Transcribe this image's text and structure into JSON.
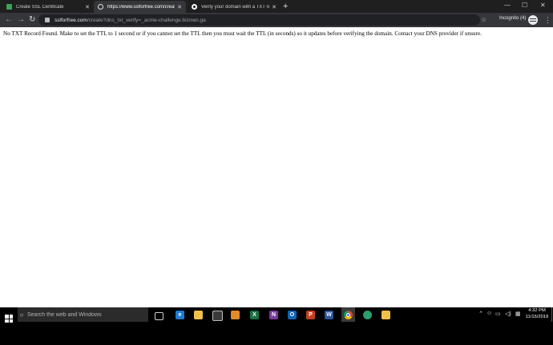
{
  "browser": {
    "tabs": [
      {
        "title": "Create SSL Certificate",
        "favicon": "lock-icon"
      },
      {
        "title": "https://www.sslforfree.com/create",
        "favicon": "globe-icon",
        "active": true
      },
      {
        "title": "Verify your domain with a TXT re",
        "favicon": "google-icon"
      }
    ],
    "toolbar": {
      "url_host": "sslforfree.com",
      "url_path": "/create?dns_txt_verify=_acme-challenge.bizown.ga",
      "profile_label": "Incognito (4)"
    }
  },
  "page": {
    "message": "No TXT Record Found. Make to set the TTL to 1 second or if you cannot set the TTL then you must wait the TTL (in seconds) so it updates before verifying the domain. Contact your DNS provider if unsure."
  },
  "taskbar": {
    "search_placeholder": "Search the web and Windows",
    "apps": [
      {
        "name": "task-view",
        "letter": "",
        "color": "#000000"
      },
      {
        "name": "edge",
        "letter": "e",
        "color": "#1e7ad1"
      },
      {
        "name": "file-explorer",
        "letter": "",
        "color": "#f0c04a"
      },
      {
        "name": "store",
        "letter": "",
        "color": "#3a3a3a"
      },
      {
        "name": "ms-edge-canary",
        "letter": "",
        "color": "#e28a2a"
      },
      {
        "name": "excel",
        "letter": "X",
        "color": "#1d7044"
      },
      {
        "name": "onenote",
        "letter": "N",
        "color": "#7a3b9a"
      },
      {
        "name": "outlook",
        "letter": "O",
        "color": "#1063b8"
      },
      {
        "name": "powerpoint",
        "letter": "P",
        "color": "#c4401f"
      },
      {
        "name": "word",
        "letter": "W",
        "color": "#2b579a"
      },
      {
        "name": "chrome",
        "letter": "",
        "color": "#3a3a3a"
      },
      {
        "name": "edge-new",
        "letter": "",
        "color": "#2aa06a"
      },
      {
        "name": "folder",
        "letter": "",
        "color": "#f0c04a"
      }
    ],
    "clock_time": "4:32 PM",
    "clock_date": "11/15/2019"
  },
  "colors": {
    "tabstrip": "#1f1f1f",
    "toolbar": "#35363a",
    "omnibox": "#202124",
    "taskbar": "#000000"
  }
}
